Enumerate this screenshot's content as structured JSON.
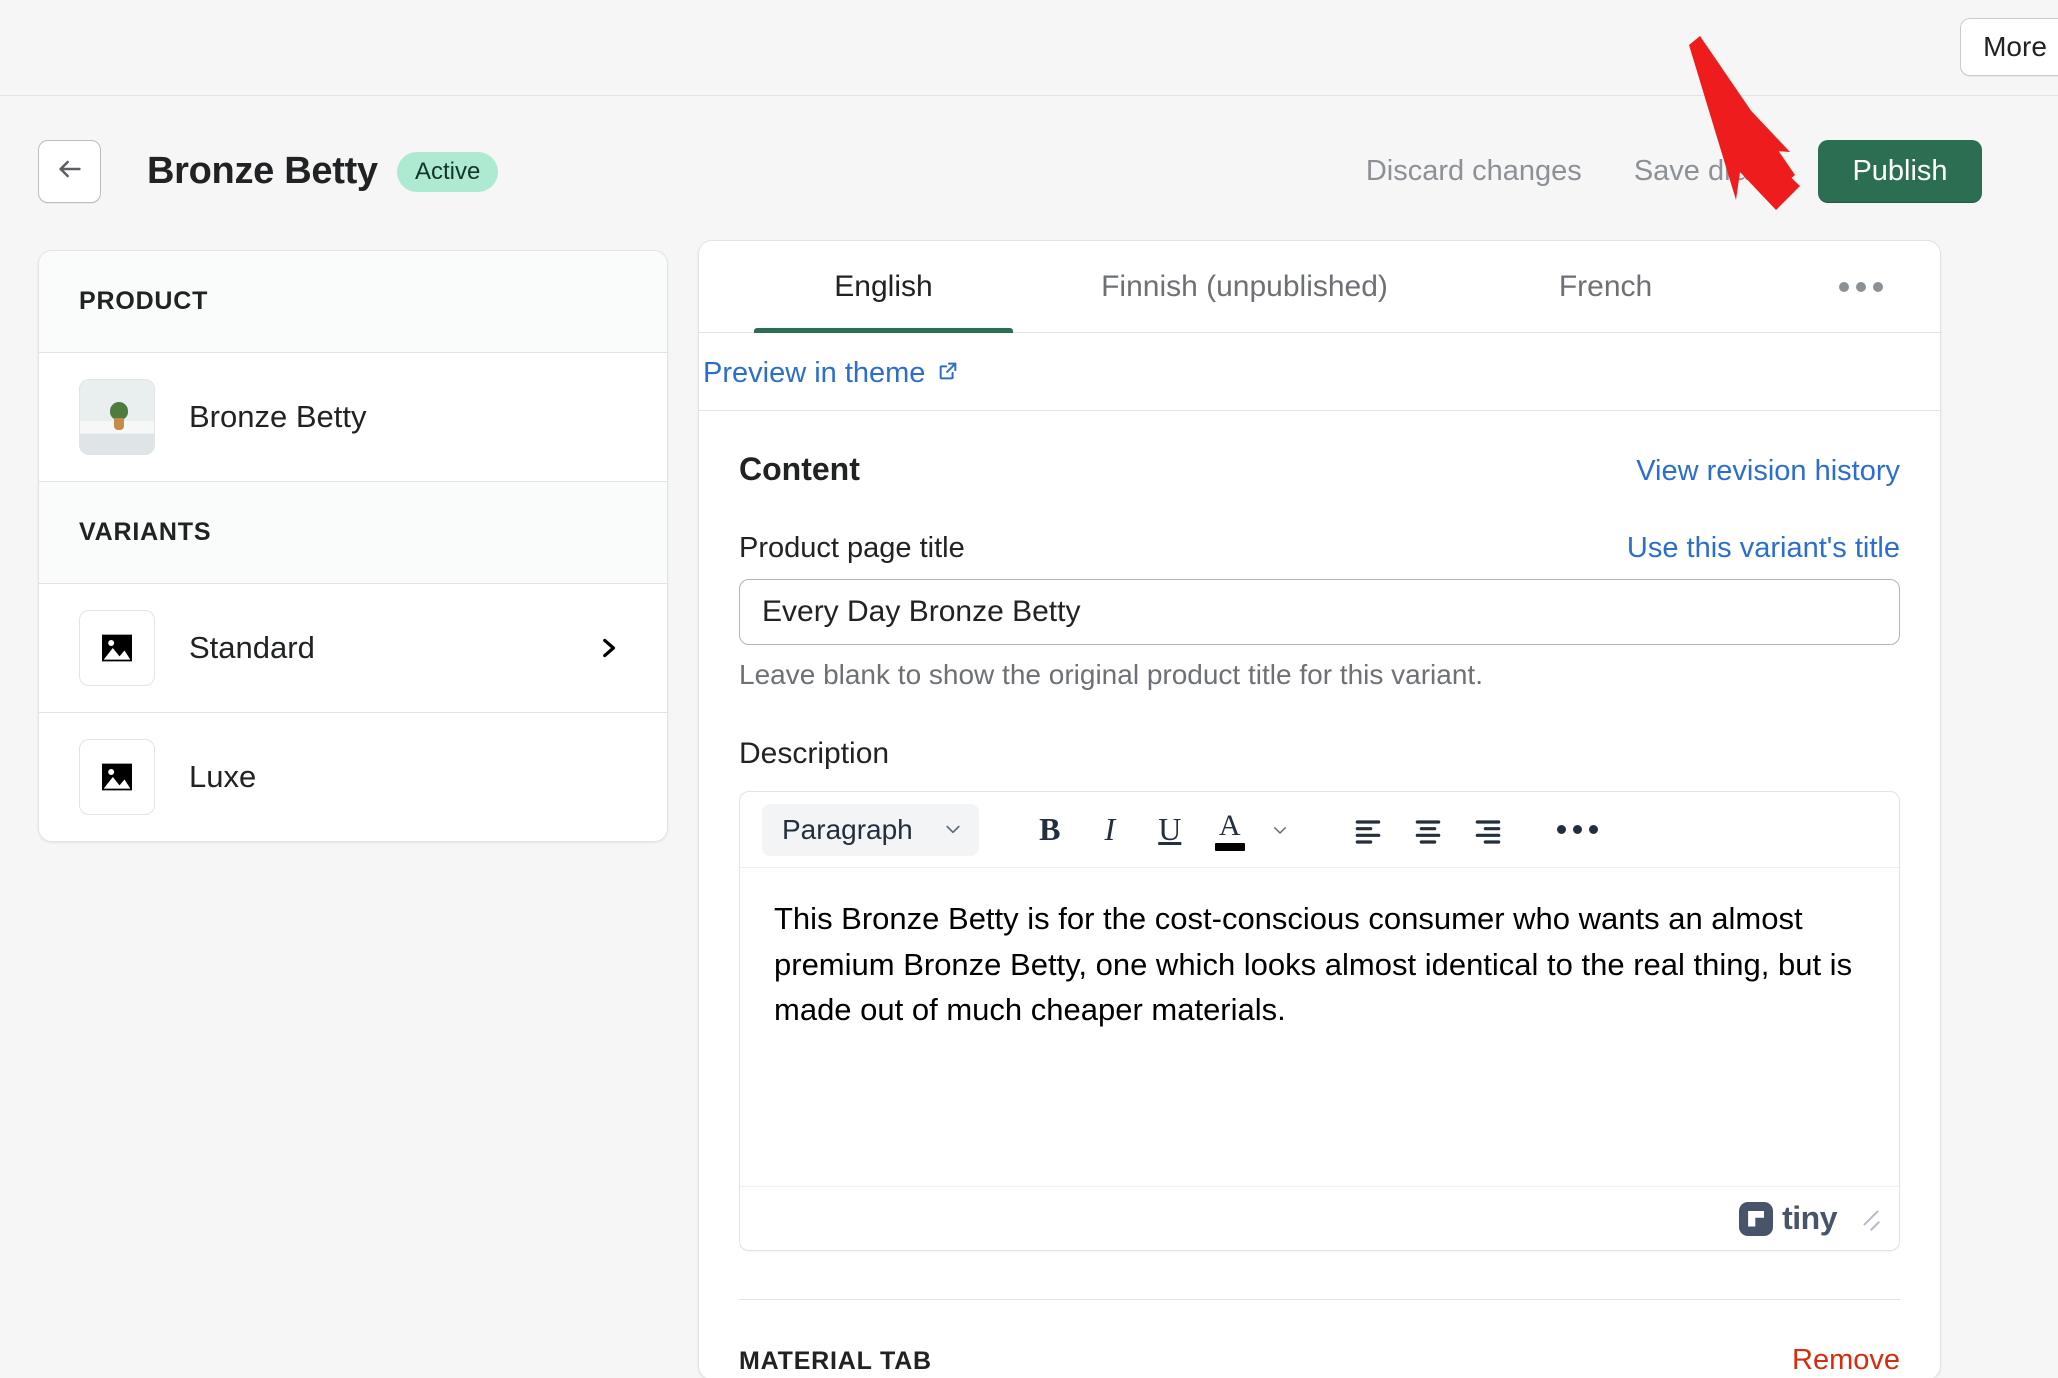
{
  "topbar": {
    "more_button_label": "More"
  },
  "header": {
    "back_label": "Back",
    "title": "Bronze Betty",
    "status_badge": "Active",
    "discard_label": "Discard changes",
    "save_draft_label": "Save draft",
    "publish_label": "Publish",
    "publish_color": "#2c6e52",
    "badge_color": "#aee9d1"
  },
  "sidebar": {
    "product_section_label": "PRODUCT",
    "product_item": {
      "label": "Bronze Betty"
    },
    "variants_section_label": "VARIANTS",
    "variants": [
      {
        "label": "Standard",
        "has_chevron": true
      },
      {
        "label": "Luxe",
        "has_chevron": false
      }
    ]
  },
  "main": {
    "tabs": [
      {
        "label": "English",
        "active": true
      },
      {
        "label": "Finnish (unpublished)",
        "active": false
      },
      {
        "label": "French",
        "active": false
      }
    ],
    "more_tabs_icon": "ellipsis-icon",
    "preview_link": "Preview in theme",
    "content_title": "Content",
    "revision_history_link": "View revision history",
    "product_page_title_label": "Product page title",
    "use_variant_title_link": "Use this variant's title",
    "product_page_title_value": "Every Day Bronze Betty",
    "product_page_title_placeholder": "",
    "product_page_title_help": "Leave blank to show the original product title for this variant.",
    "description_label": "Description",
    "editor": {
      "format_select_value": "Paragraph",
      "buttons": {
        "bold": "B",
        "italic": "I",
        "underline": "U",
        "text_color": "A",
        "align_left": "align-left-icon",
        "align_center": "align-center-icon",
        "align_right": "align-right-icon",
        "more": "ellipsis-icon"
      },
      "body_text": "This Bronze Betty is for the cost-conscious consumer who wants an almost premium Bronze Betty, one which looks almost identical to the real thing, but is made out of much cheaper materials.",
      "branding": "tiny"
    },
    "material_section_label": "MATERIAL TAB",
    "material_remove_link": "Remove",
    "link_color": "#2c6ecb",
    "remove_color": "#d72c0d"
  },
  "annotation": {
    "arrow_color": "#ee1c1c"
  }
}
